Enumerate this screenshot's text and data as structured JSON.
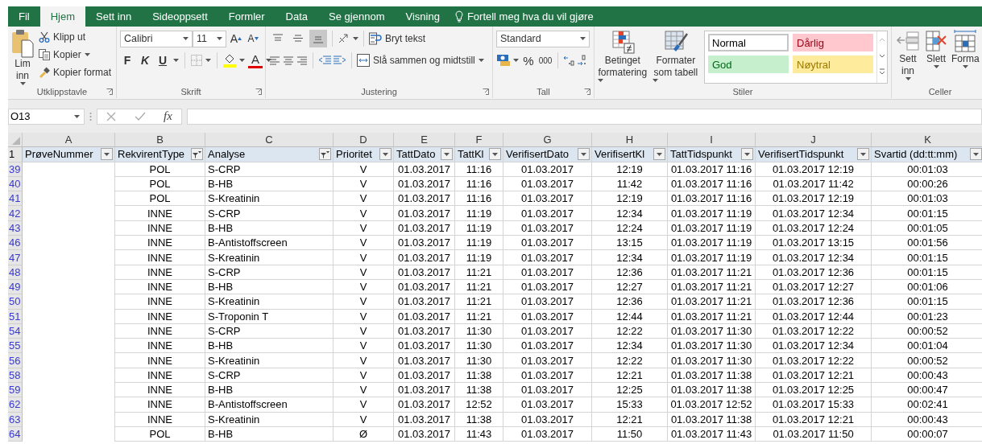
{
  "tabs": [
    {
      "label": "Fil",
      "selected": false
    },
    {
      "label": "Hjem",
      "selected": true
    },
    {
      "label": "Sett inn",
      "selected": false
    },
    {
      "label": "Sideoppsett",
      "selected": false
    },
    {
      "label": "Formler",
      "selected": false
    },
    {
      "label": "Data",
      "selected": false
    },
    {
      "label": "Se gjennom",
      "selected": false
    },
    {
      "label": "Visning",
      "selected": false
    }
  ],
  "tell_me": "Fortell meg hva du vil gjøre",
  "ribbon": {
    "clipboard": {
      "label": "Utklippstavle",
      "paste": "Lim inn",
      "actions": [
        {
          "kind": "cut",
          "label": "Klipp ut",
          "menu": false
        },
        {
          "kind": "copy",
          "label": "Kopier",
          "menu": true
        },
        {
          "kind": "format-painter",
          "label": "Kopier format",
          "menu": false
        }
      ]
    },
    "font": {
      "label": "Skrift",
      "font_name": "Calibri",
      "font_size": "11",
      "grow": "A",
      "shrink": "A",
      "bold": "F",
      "italic": "K",
      "underline": "U",
      "font_color": "A"
    },
    "alignment": {
      "label": "Justering",
      "vertical": [
        {
          "kind": "top",
          "selected": false
        },
        {
          "kind": "middle",
          "selected": false
        },
        {
          "kind": "bottom",
          "selected": true
        }
      ],
      "wrap": "Bryt tekst",
      "merge": "Slå sammen og midtstill"
    },
    "number": {
      "label": "Tall",
      "format": "Standard",
      "percent": "%",
      "thousands": "000"
    },
    "styles": {
      "label": "Stiler",
      "conditional": "Betinget formatering",
      "as_table": "Formater som tabell",
      "cells": [
        {
          "label": "Normal",
          "color": "#ffffff"
        },
        {
          "label": "Dårlig",
          "color": "#ffc7ce"
        },
        {
          "label": "God",
          "color": "#c6efce"
        },
        {
          "label": "Nøytral",
          "color": "#ffeb9c"
        }
      ]
    },
    "cells": {
      "label": "Celler",
      "buttons": [
        {
          "kind": "insert",
          "label": "Sett inn"
        },
        {
          "kind": "delete",
          "label": "Slett"
        },
        {
          "kind": "format",
          "label": "Forma"
        }
      ]
    }
  },
  "formula_bar": {
    "name_box": "O13",
    "function_label": "fx"
  },
  "sheet": {
    "header_row_number": "1",
    "columns": [
      {
        "letter": "A",
        "header": "PrøveNummer",
        "filtered": false
      },
      {
        "letter": "B",
        "header": "RekvirentType",
        "filtered": true
      },
      {
        "letter": "C",
        "header": "Analyse",
        "filtered": true
      },
      {
        "letter": "D",
        "header": "Prioritet",
        "filtered": false
      },
      {
        "letter": "E",
        "header": "TattDato",
        "filtered": false
      },
      {
        "letter": "F",
        "header": "TattKl",
        "filtered": false
      },
      {
        "letter": "G",
        "header": "VerifisertDato",
        "filtered": false
      },
      {
        "letter": "H",
        "header": "VerifisertKl",
        "filtered": false
      },
      {
        "letter": "I",
        "header": "TattTidspunkt",
        "filtered": false
      },
      {
        "letter": "J",
        "header": "VerifisertTidspunkt",
        "filtered": false
      },
      {
        "letter": "K",
        "header": "Svartid (dd:tt:mm)",
        "filtered": false
      }
    ],
    "rows": [
      {
        "number": "39",
        "cells": [
          "",
          "POL",
          "S-CRP",
          "V",
          "01.03.2017",
          "11:16",
          "01.03.2017",
          "12:19",
          "01.03.2017 11:16",
          "01.03.2017 12:19",
          "00:01:03"
        ]
      },
      {
        "number": "40",
        "cells": [
          "",
          "POL",
          "B-HB",
          "V",
          "01.03.2017",
          "11:16",
          "01.03.2017",
          "11:42",
          "01.03.2017 11:16",
          "01.03.2017 11:42",
          "00:00:26"
        ]
      },
      {
        "number": "41",
        "cells": [
          "",
          "POL",
          "S-Kreatinin",
          "V",
          "01.03.2017",
          "11:16",
          "01.03.2017",
          "12:19",
          "01.03.2017 11:16",
          "01.03.2017 12:19",
          "00:01:03"
        ]
      },
      {
        "number": "42",
        "cells": [
          "",
          "INNE",
          "S-CRP",
          "V",
          "01.03.2017",
          "11:19",
          "01.03.2017",
          "12:34",
          "01.03.2017 11:19",
          "01.03.2017 12:34",
          "00:01:15"
        ]
      },
      {
        "number": "43",
        "cells": [
          "",
          "INNE",
          "B-HB",
          "V",
          "01.03.2017",
          "11:19",
          "01.03.2017",
          "12:24",
          "01.03.2017 11:19",
          "01.03.2017 12:24",
          "00:01:05"
        ]
      },
      {
        "number": "46",
        "cells": [
          "",
          "INNE",
          "B-Antistoffscreen",
          "V",
          "01.03.2017",
          "11:19",
          "01.03.2017",
          "13:15",
          "01.03.2017 11:19",
          "01.03.2017 13:15",
          "00:01:56"
        ]
      },
      {
        "number": "47",
        "cells": [
          "",
          "INNE",
          "S-Kreatinin",
          "V",
          "01.03.2017",
          "11:19",
          "01.03.2017",
          "12:34",
          "01.03.2017 11:19",
          "01.03.2017 12:34",
          "00:01:15"
        ]
      },
      {
        "number": "48",
        "cells": [
          "",
          "INNE",
          "S-CRP",
          "V",
          "01.03.2017",
          "11:21",
          "01.03.2017",
          "12:36",
          "01.03.2017 11:21",
          "01.03.2017 12:36",
          "00:01:15"
        ]
      },
      {
        "number": "49",
        "cells": [
          "",
          "INNE",
          "B-HB",
          "V",
          "01.03.2017",
          "11:21",
          "01.03.2017",
          "12:27",
          "01.03.2017 11:21",
          "01.03.2017 12:27",
          "00:01:06"
        ]
      },
      {
        "number": "50",
        "cells": [
          "",
          "INNE",
          "S-Kreatinin",
          "V",
          "01.03.2017",
          "11:21",
          "01.03.2017",
          "12:36",
          "01.03.2017 11:21",
          "01.03.2017 12:36",
          "00:01:15"
        ]
      },
      {
        "number": "51",
        "cells": [
          "",
          "INNE",
          "S-Troponin T",
          "V",
          "01.03.2017",
          "11:21",
          "01.03.2017",
          "12:44",
          "01.03.2017 11:21",
          "01.03.2017 12:44",
          "00:01:23"
        ]
      },
      {
        "number": "54",
        "cells": [
          "",
          "INNE",
          "S-CRP",
          "V",
          "01.03.2017",
          "11:30",
          "01.03.2017",
          "12:22",
          "01.03.2017 11:30",
          "01.03.2017 12:22",
          "00:00:52"
        ]
      },
      {
        "number": "55",
        "cells": [
          "",
          "INNE",
          "B-HB",
          "V",
          "01.03.2017",
          "11:30",
          "01.03.2017",
          "12:34",
          "01.03.2017 11:30",
          "01.03.2017 12:34",
          "00:01:04"
        ]
      },
      {
        "number": "56",
        "cells": [
          "",
          "INNE",
          "S-Kreatinin",
          "V",
          "01.03.2017",
          "11:30",
          "01.03.2017",
          "12:22",
          "01.03.2017 11:30",
          "01.03.2017 12:22",
          "00:00:52"
        ]
      },
      {
        "number": "58",
        "cells": [
          "",
          "INNE",
          "S-CRP",
          "V",
          "01.03.2017",
          "11:38",
          "01.03.2017",
          "12:21",
          "01.03.2017 11:38",
          "01.03.2017 12:21",
          "00:00:43"
        ]
      },
      {
        "number": "59",
        "cells": [
          "",
          "INNE",
          "B-HB",
          "V",
          "01.03.2017",
          "11:38",
          "01.03.2017",
          "12:25",
          "01.03.2017 11:38",
          "01.03.2017 12:25",
          "00:00:47"
        ]
      },
      {
        "number": "62",
        "cells": [
          "",
          "INNE",
          "B-Antistoffscreen",
          "V",
          "01.03.2017",
          "12:52",
          "01.03.2017",
          "15:33",
          "01.03.2017 12:52",
          "01.03.2017 15:33",
          "00:02:41"
        ]
      },
      {
        "number": "63",
        "cells": [
          "",
          "INNE",
          "S-Kreatinin",
          "V",
          "01.03.2017",
          "11:38",
          "01.03.2017",
          "12:21",
          "01.03.2017 11:38",
          "01.03.2017 12:21",
          "00:00:43"
        ]
      },
      {
        "number": "64",
        "cells": [
          "",
          "POL",
          "B-HB",
          "Ø",
          "01.03.2017",
          "11:43",
          "01.03.2017",
          "11:50",
          "01.03.2017 11:43",
          "01.03.2017 11:50",
          "00:00:07"
        ]
      }
    ]
  }
}
